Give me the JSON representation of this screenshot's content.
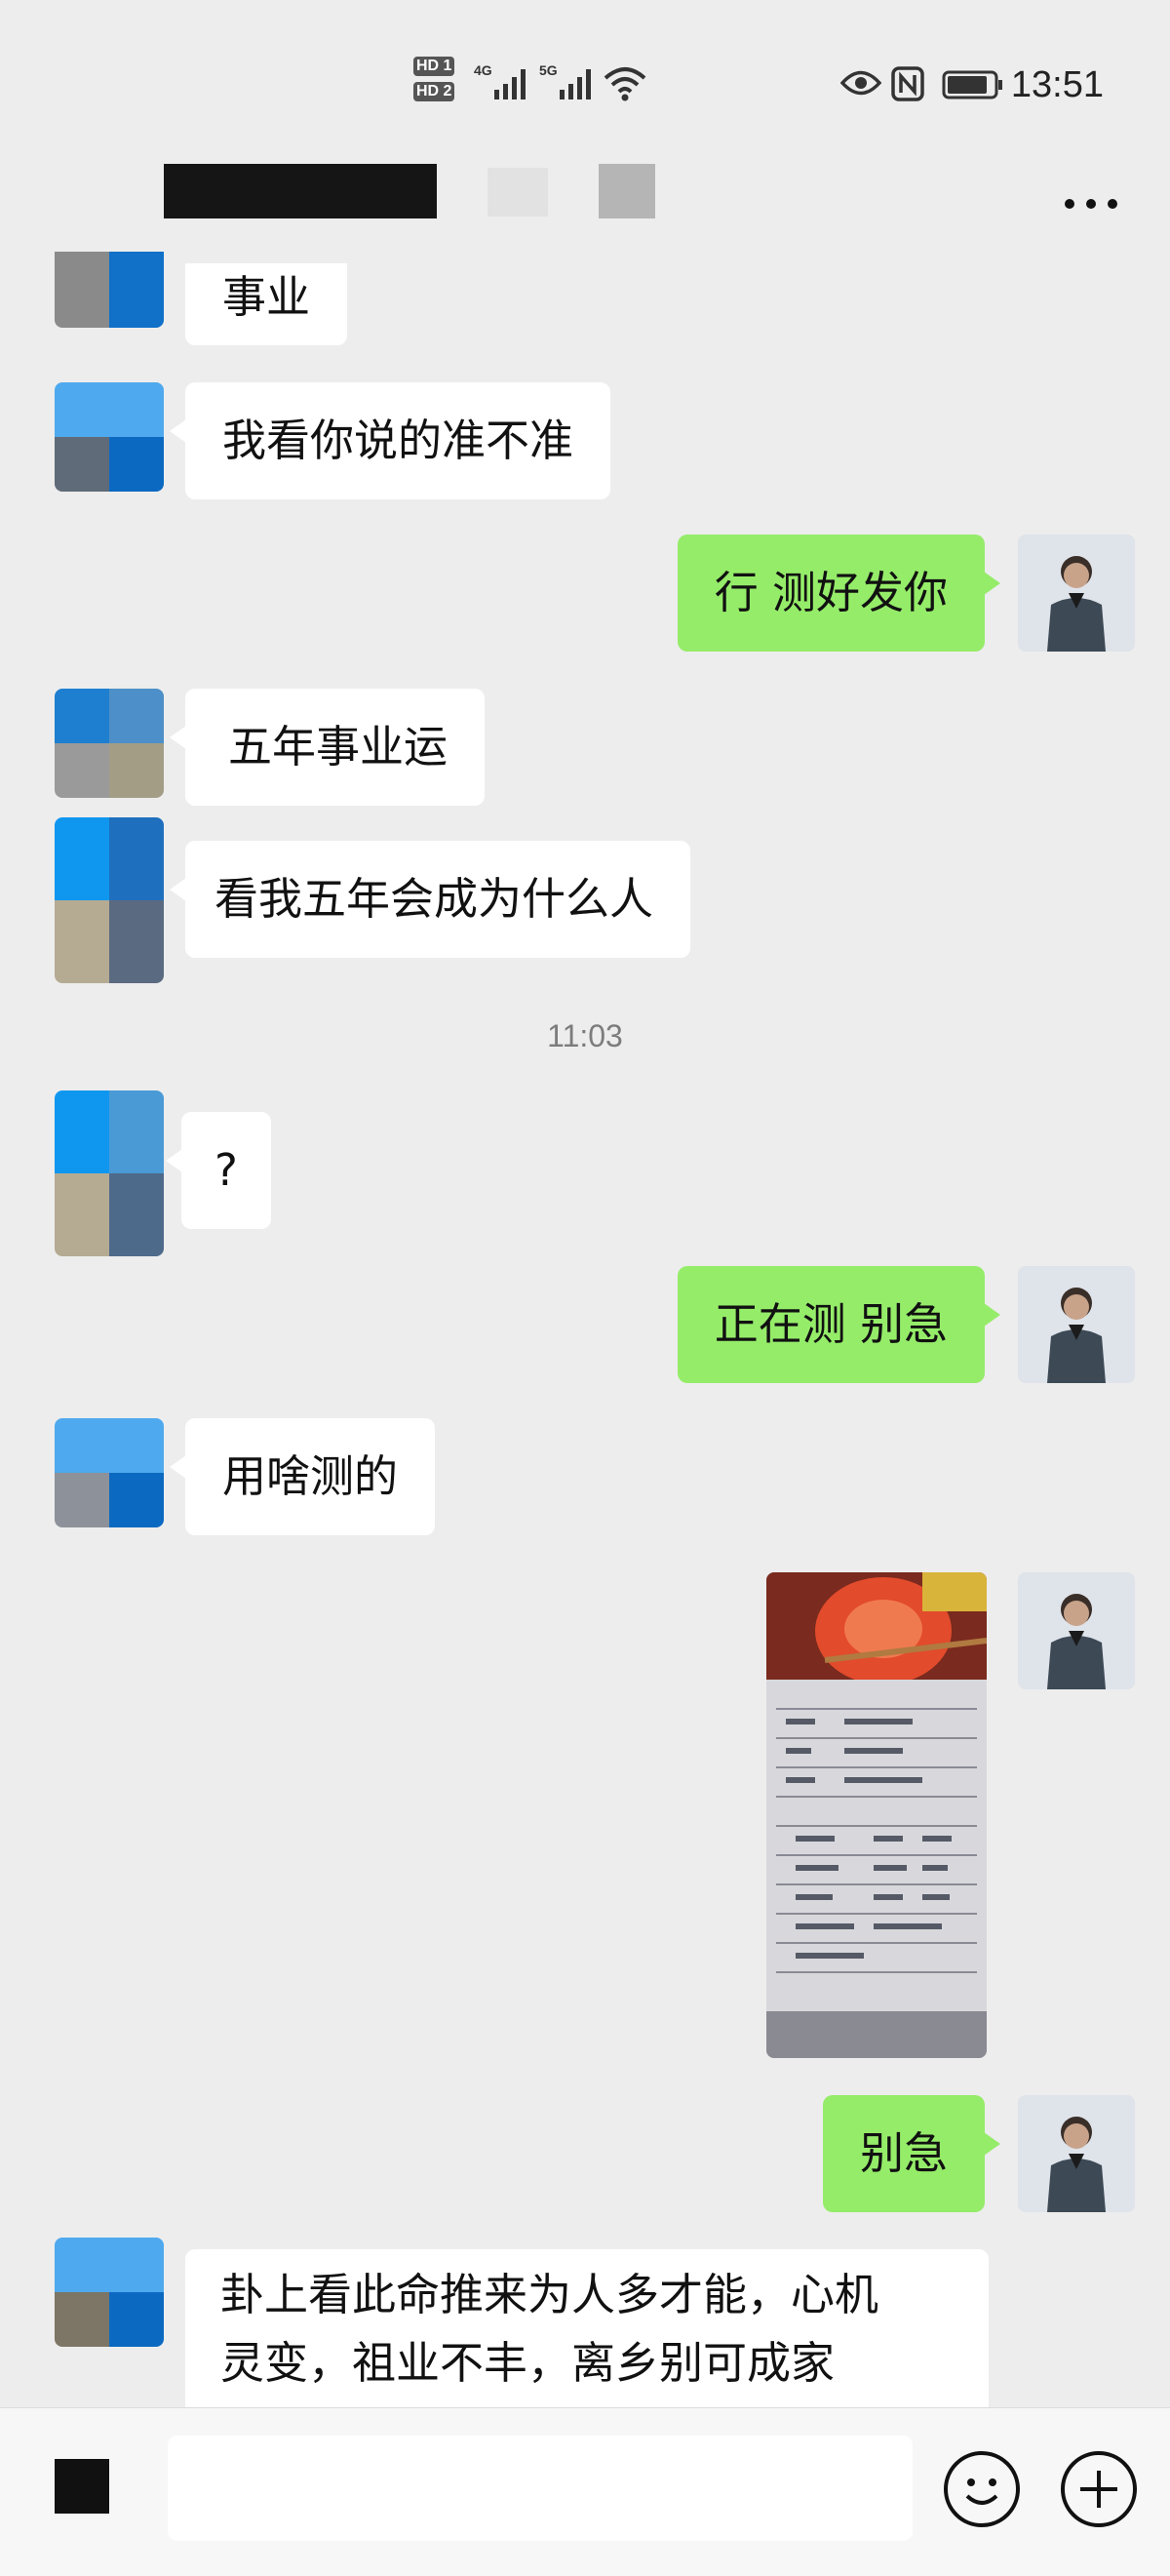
{
  "status_bar": {
    "time": "13:51",
    "hd1": "HD 1",
    "hd2": "HD 2",
    "net1": "4G",
    "net2": "5G"
  },
  "header": {
    "more_label": "..."
  },
  "messages": [
    {
      "side": "left",
      "text": "事业"
    },
    {
      "side": "left",
      "text": "我看你说的准不准"
    },
    {
      "side": "right",
      "text": "行 测好发你"
    },
    {
      "side": "left",
      "text": "五年事业运"
    },
    {
      "side": "left",
      "text": "看我五年会成为什么人"
    },
    {
      "side": "left",
      "text": "?"
    },
    {
      "side": "right",
      "text": "正在测 别急"
    },
    {
      "side": "left",
      "text": "用啥测的"
    },
    {
      "side": "right",
      "text": "别急"
    },
    {
      "side": "left",
      "text_line1": "卦上看此命推来为人多才能，心机",
      "text_line2": "灵变，祖业不丰，离乡别可成家"
    }
  ],
  "timestamp": "11:03",
  "input": {
    "placeholder": ""
  },
  "icons": {
    "more": "more-icon",
    "emoji": "emoji-icon",
    "add": "plus-icon",
    "voice": "voice-icon"
  },
  "colors": {
    "background": "#ededed",
    "bubble_self": "#95ec69",
    "bubble_other": "#ffffff"
  }
}
